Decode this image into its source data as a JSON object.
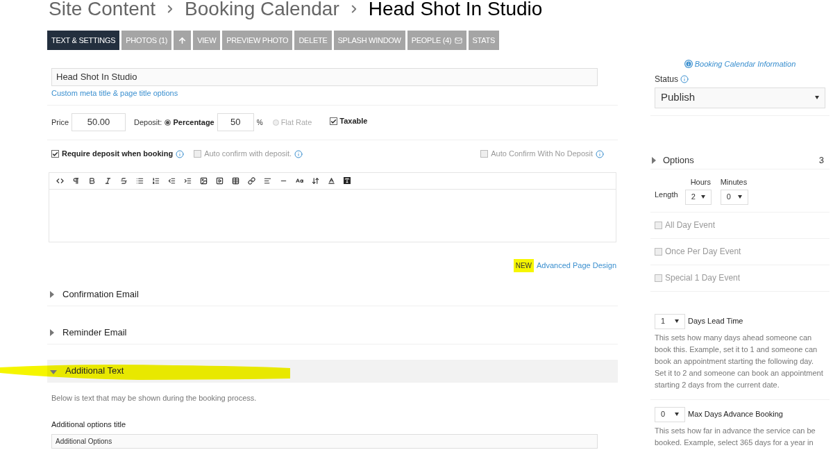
{
  "breadcrumb": [
    {
      "label": "Site Content",
      "current": false
    },
    {
      "label": "Booking Calendar",
      "current": false
    },
    {
      "label": "Head Shot In Studio",
      "current": true
    }
  ],
  "tabs": [
    {
      "kind": "text",
      "label": "TEXT & SETTINGS",
      "selected": true
    },
    {
      "kind": "text",
      "label": "PHOTOS (1)",
      "selected": false
    },
    {
      "kind": "upload",
      "selected": false
    },
    {
      "kind": "text",
      "label": "VIEW",
      "selected": false
    },
    {
      "kind": "text",
      "label": "PREVIEW PHOTO",
      "selected": false
    },
    {
      "kind": "text",
      "label": "DELETE",
      "selected": false
    },
    {
      "kind": "text",
      "label": "SPLASH WINDOW",
      "selected": false
    },
    {
      "kind": "people",
      "label": "PEOPLE (4)",
      "selected": false
    },
    {
      "kind": "text",
      "label": "STATS",
      "selected": false
    }
  ],
  "title_field": {
    "value": "Head Shot In Studio"
  },
  "meta_link": "Custom meta title & page title options",
  "pricing": {
    "price_label": "Price",
    "price": "50.00",
    "deposit_label": "Deposit:",
    "deposit_types": [
      {
        "label": "Percentage",
        "selected": true
      },
      {
        "label": "Flat Rate",
        "selected": false
      }
    ],
    "deposit_value": "50",
    "percent_sign": "%",
    "taxable": {
      "label": "Taxable",
      "checked": true
    }
  },
  "deposit_options": [
    {
      "label": "Require deposit when booking",
      "checked": true
    },
    {
      "label": "Auto confirm with deposit.",
      "checked": false
    },
    {
      "label": "Auto Confirm With No Deposit",
      "checked": false
    }
  ],
  "advanced": {
    "badge": "NEW",
    "link": "Advanced Page Design"
  },
  "sections": [
    {
      "title": "Confirmation Email",
      "expanded": false,
      "highlighted": false
    },
    {
      "title": "Reminder Email",
      "expanded": false,
      "highlighted": false
    },
    {
      "title": "Additional Text",
      "expanded": true,
      "highlighted": true
    }
  ],
  "additional_text": {
    "intro": "Below is text that may be shown during the booking process.",
    "fields": [
      {
        "label": "Additional options title",
        "value": "Additional Options"
      }
    ]
  },
  "sidebar": {
    "info_link": "Booking Calendar Information",
    "status_label": "Status",
    "status": "Publish",
    "options": {
      "title": "Options",
      "count": "3",
      "expanded": false
    },
    "length": {
      "label": "Length",
      "hours_label": "Hours",
      "hours": "2",
      "minutes_label": "Minutes",
      "minutes": "0"
    },
    "events": [
      {
        "label": "All Day Event",
        "checked": false
      },
      {
        "label": "Once Per Day Event",
        "checked": false
      },
      {
        "label": "Special 1 Day Event",
        "checked": false
      }
    ],
    "lead": [
      {
        "value": "1",
        "label": "Days Lead Time",
        "help": "This sets how many days ahead someone can book this. Example, set it to 1 and someone can book an appointment starting the following day. Set it to 2 and someone can book an appointment starting 2 days from the current date."
      },
      {
        "value": "0",
        "label": "Max Days Advance Booking",
        "help": "This sets how far in advance the service can be booked. Example, select 365 days for a year in"
      }
    ]
  }
}
